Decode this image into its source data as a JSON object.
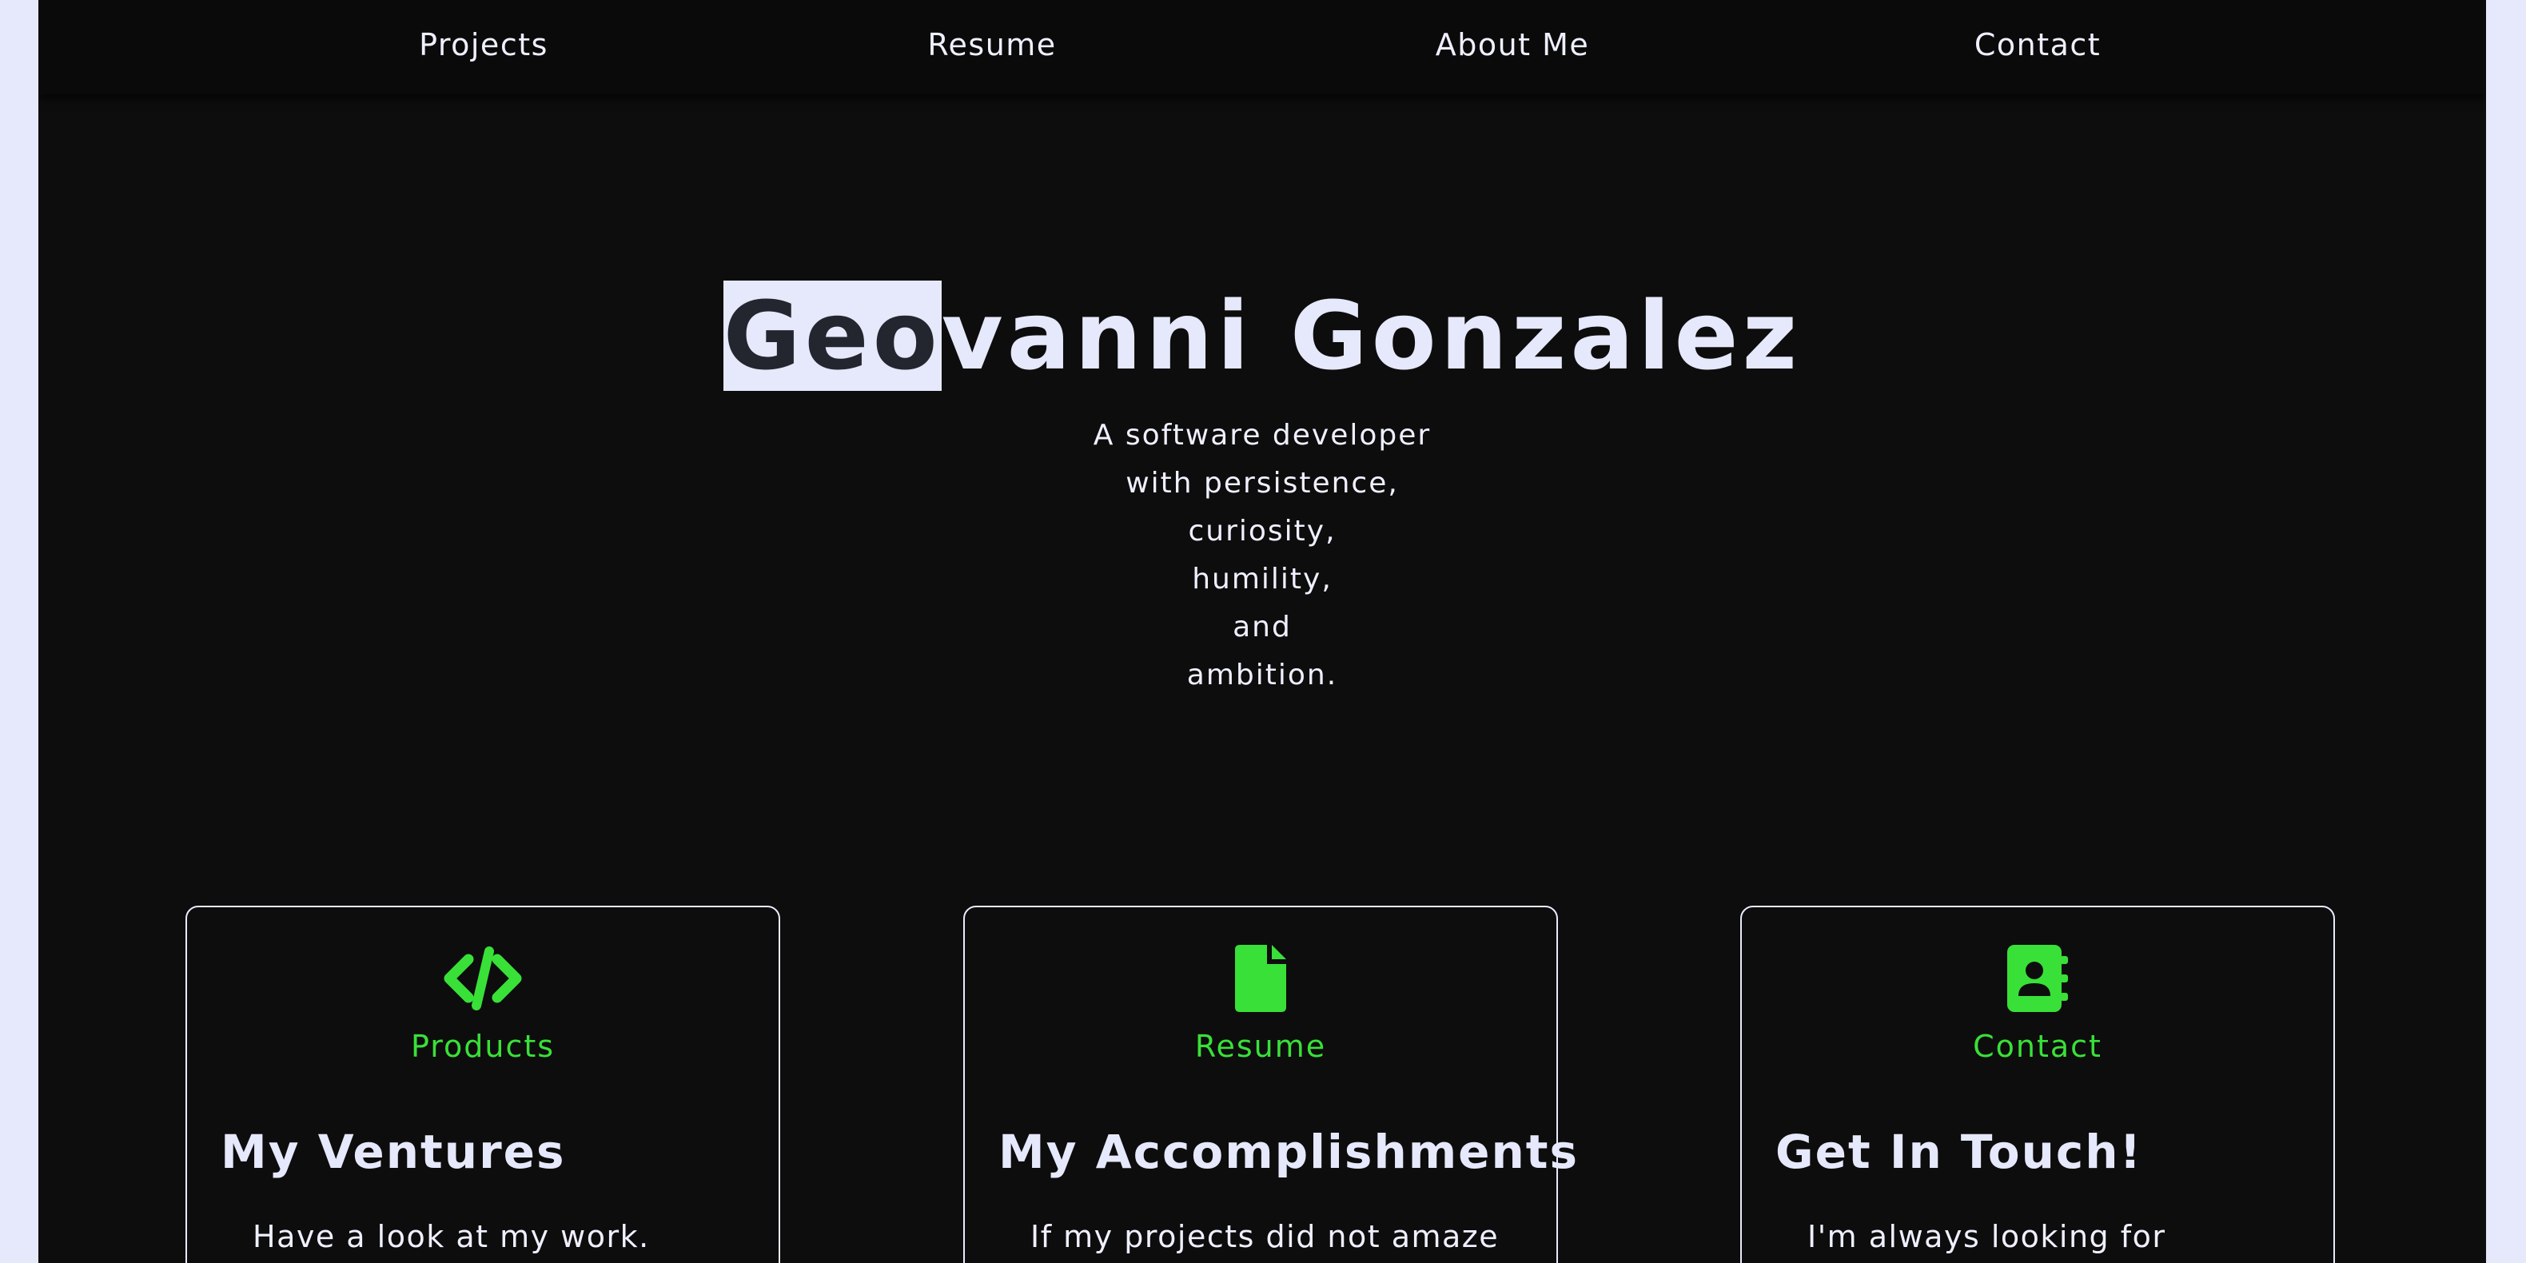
{
  "nav": {
    "items": [
      {
        "label": "Projects"
      },
      {
        "label": "Resume"
      },
      {
        "label": "About Me"
      },
      {
        "label": "Contact"
      }
    ]
  },
  "hero": {
    "name_highlighted": "Geo",
    "name_rest": "vanni Gonzalez",
    "tagline": [
      "A software developer",
      "with persistence,",
      "curiosity,",
      "humility,",
      "and",
      "ambition."
    ]
  },
  "cards": [
    {
      "icon": "code-icon",
      "label": "Products",
      "title": "My Ventures",
      "text": "Have a look at my work."
    },
    {
      "icon": "file-icon",
      "label": "Resume",
      "title": "My Accomplishments",
      "text": "If my projects did not amaze"
    },
    {
      "icon": "address-book-icon",
      "label": "Contact",
      "title": "Get In Touch!",
      "text": "I'm always looking for"
    }
  ],
  "colors": {
    "accent": "#39e038",
    "background": "#0d0d0d",
    "text": "#e6e8fb",
    "highlight": "#e6e8fb"
  }
}
